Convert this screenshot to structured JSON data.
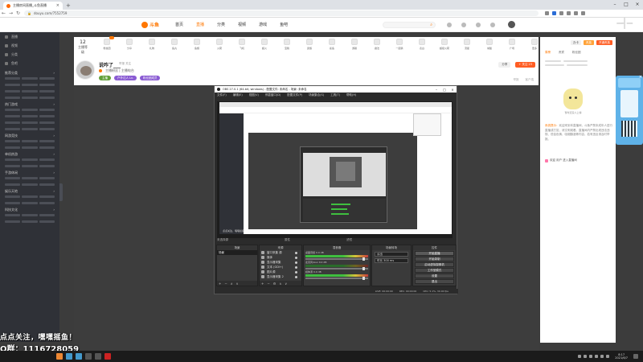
{
  "browser": {
    "tab_title": "主播房间直播_斗鱼直播",
    "url": "douyu.com/7552759"
  },
  "site": {
    "logo_text": "斗鱼",
    "nav": [
      "首页",
      "直播",
      "分类",
      "视频",
      "游戏",
      "鱼吧"
    ],
    "active_nav": 1
  },
  "stats": {
    "level_number": "12",
    "level_label": "主播等级",
    "gifts": [
      "粉丝团",
      "分享",
      "礼物",
      "鱼丸",
      "鱼翅",
      "火箭",
      "飞机",
      "超火",
      "宝箱",
      "贵族",
      "鲨鱼",
      "游艇",
      "魔法",
      "一起猜",
      "表白",
      "超级火箭",
      "流星",
      "城堡",
      "广场",
      "更多"
    ]
  },
  "streamer": {
    "name": "说咋了___",
    "meta": "举报  关注",
    "line2": "主播粉丝  |  主播电台",
    "tags": [
      {
        "text": "主播",
        "style": "g"
      },
      {
        "text": "户外达人 Lv.",
        "style": "p"
      },
      {
        "text": "粉丝团成员",
        "style": "p"
      }
    ],
    "right_buttons": [
      {
        "text": "分享",
        "style": ""
      },
      {
        "text": "+ 关注 23",
        "style": "red"
      }
    ],
    "right_sub": [
      "举报",
      "客户端"
    ]
  },
  "sidebar": {
    "top_items": [
      "直播",
      "视频",
      "分类",
      "鱼吧"
    ],
    "sections": [
      "推荐分类",
      "热门游戏",
      "网游竞技",
      "单机热游",
      "手游休闲",
      "娱乐天地",
      "科技文化"
    ]
  },
  "obs": {
    "title": "OBS 27.0.1 (64-bit, windows) - 配置文件: 未命名 - 场景: 未命名",
    "menu": [
      "文件(F)",
      "编辑(E)",
      "视图(V)",
      "停靠窗口(D)",
      "配置文件(P)",
      "场景集合(S)",
      "工具(T)",
      "帮助(H)"
    ],
    "dock_labels": [
      "未选择源",
      "属性",
      "滤镜"
    ],
    "scenes_title": "场景",
    "scenes": [
      "场景"
    ],
    "sources_title": "来源",
    "sources": [
      "窗口采集 源",
      "媒体",
      "显示器采集",
      "文本 (GDI+)",
      "图片源",
      "显示器采集 2"
    ],
    "mixer_title": "混音器",
    "mixer": [
      {
        "label": "桌面音频  0.0 dB",
        "dim": false
      },
      {
        "label": "麦克风/Aux  0.0 dB",
        "dim": true
      },
      {
        "label": "媒体源  0.0 dB",
        "dim": false
      }
    ],
    "transitions_title": "场景转场",
    "transition": "淡出",
    "duration": "时长  300 ms",
    "controls_title": "控件",
    "controls": [
      "开始直播",
      "开始录制",
      "启动虚拟摄像机",
      "工作室模式",
      "设置",
      "退出"
    ],
    "status": [
      "LIVE: 00:00:00",
      "REC: 00:00:00",
      "CPU: 5.1%, 30.00 fps"
    ],
    "nested_footer": "点点关注，嘿嘿摇鱼！"
  },
  "rightcol": {
    "buttons": [
      {
        "text": "办卡",
        "style": ""
      },
      {
        "text": "贵族",
        "style": "orange"
      },
      {
        "text": "开通贵族",
        "style": "red"
      }
    ],
    "tabs": [
      "周榜",
      "贵宾",
      "粉丝团"
    ],
    "mascot_caption": "暂时还没人上榜",
    "chat_lines": [
      {
        "user": "系统提示：",
        "text": "欢迎来到本直播间，斗鱼严禁未成年人进行直播或打赏，请文明观看。直播间内严禁出现违法违规、低俗色情、吸烟酗酒等内容，若有违反请及时举报。"
      }
    ],
    "chat2": "欢迎 用户 进入直播间"
  },
  "overlay": {
    "line1": "点点关注，嘿嘿摇鱼！",
    "line2": "Q群：1116728059"
  },
  "taskbar": {
    "time": "8:17",
    "date": "2021/6/7"
  }
}
